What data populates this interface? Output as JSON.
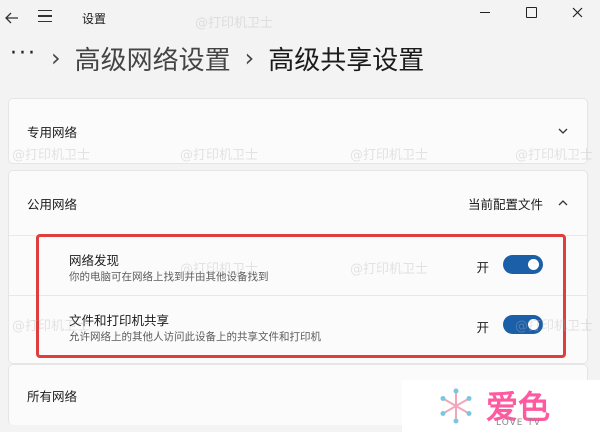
{
  "window": {
    "title": "设置"
  },
  "breadcrumb": {
    "more": "···",
    "parent": "高级网络设置",
    "current": "高级共享设置"
  },
  "sections": {
    "private": {
      "label": "专用网络"
    },
    "public": {
      "label": "公用网络",
      "badge": "当前配置文件",
      "items": [
        {
          "title": "网络发现",
          "desc": "你的电脑可在网络上找到并由其他设备找到",
          "state_label": "开",
          "on": true
        },
        {
          "title": "文件和打印机共享",
          "desc": "允许网络上的其他人访问此设备上的共享文件和打印机",
          "state_label": "开",
          "on": true
        }
      ]
    },
    "all": {
      "label": "所有网络"
    }
  },
  "watermark": "@打印机卫士",
  "logo": {
    "text": "爱色",
    "sub": "LOVE TV"
  },
  "colors": {
    "toggle_on": "#1b5fa8",
    "highlight": "#e03d3d",
    "logo": "#ff5aa0"
  }
}
